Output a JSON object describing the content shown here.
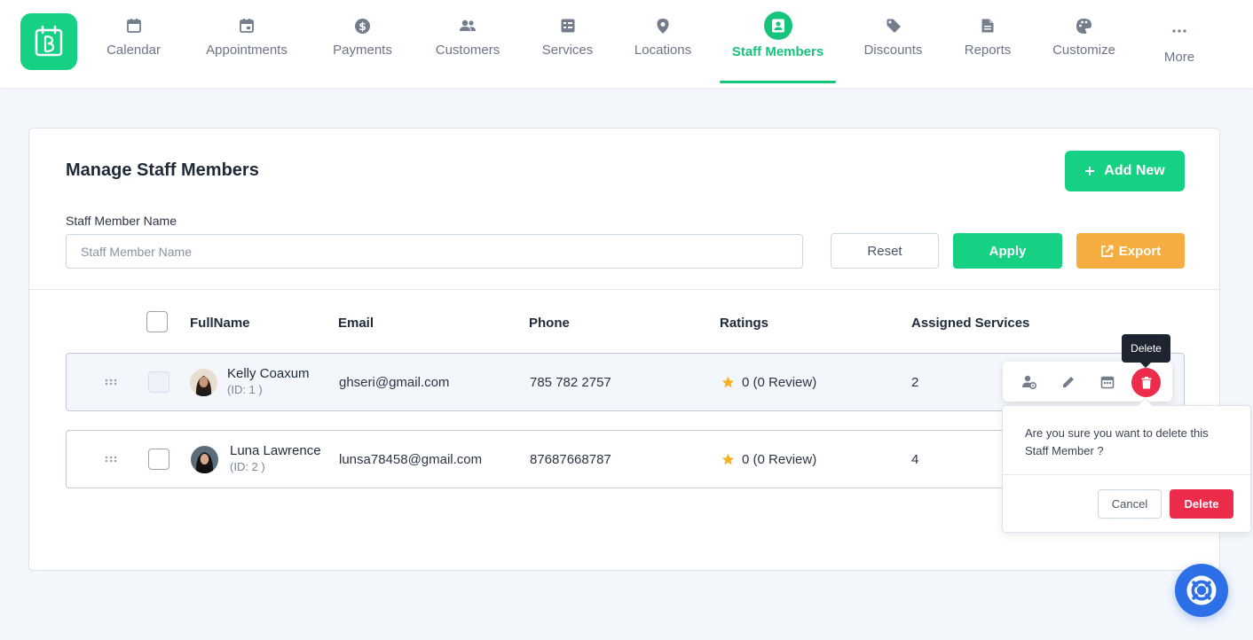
{
  "nav": {
    "items": [
      {
        "label": "Calendar",
        "icon": "calendar-icon"
      },
      {
        "label": "Appointments",
        "icon": "appointment-icon"
      },
      {
        "label": "Payments",
        "icon": "dollar-icon"
      },
      {
        "label": "Customers",
        "icon": "users-icon"
      },
      {
        "label": "Services",
        "icon": "services-icon"
      },
      {
        "label": "Locations",
        "icon": "location-pin-icon"
      },
      {
        "label": "Staff Members",
        "icon": "staff-badge-icon",
        "active": true
      },
      {
        "label": "Discounts",
        "icon": "tag-icon"
      },
      {
        "label": "Reports",
        "icon": "report-icon"
      },
      {
        "label": "Customize",
        "icon": "palette-icon"
      },
      {
        "label": "More",
        "icon": "more-dots-icon"
      }
    ]
  },
  "page": {
    "title": "Manage Staff Members",
    "add_label": "Add New",
    "filter_label": "Staff Member Name",
    "search_placeholder": "Staff Member Name",
    "reset_label": "Reset",
    "apply_label": "Apply",
    "export_label": "Export"
  },
  "table": {
    "headers": {
      "fullname": "FullName",
      "email": "Email",
      "phone": "Phone",
      "ratings": "Ratings",
      "assigned": "Assigned Services"
    },
    "rows": [
      {
        "name": "Kelly Coaxum",
        "id": "(ID: 1 )",
        "email": "ghseri@gmail.com",
        "phone": "785 782 2757",
        "rating": "0 (0 Review)",
        "assigned": "2"
      },
      {
        "name": "Luna Lawrence",
        "id": "(ID: 2 )",
        "email": "lunsa78458@gmail.com",
        "phone": "87687668787",
        "rating": "0 (0 Review)",
        "assigned": "4"
      }
    ]
  },
  "tooltip": "Delete",
  "confirm": {
    "message": "Are you sure you want to delete this Staff Member ?",
    "cancel": "Cancel",
    "delete": "Delete"
  },
  "colors": {
    "brand": "#16d184",
    "danger": "#ed2b4b",
    "export": "#f5ad41",
    "help": "#2d6fe6",
    "star": "#f5b321"
  }
}
